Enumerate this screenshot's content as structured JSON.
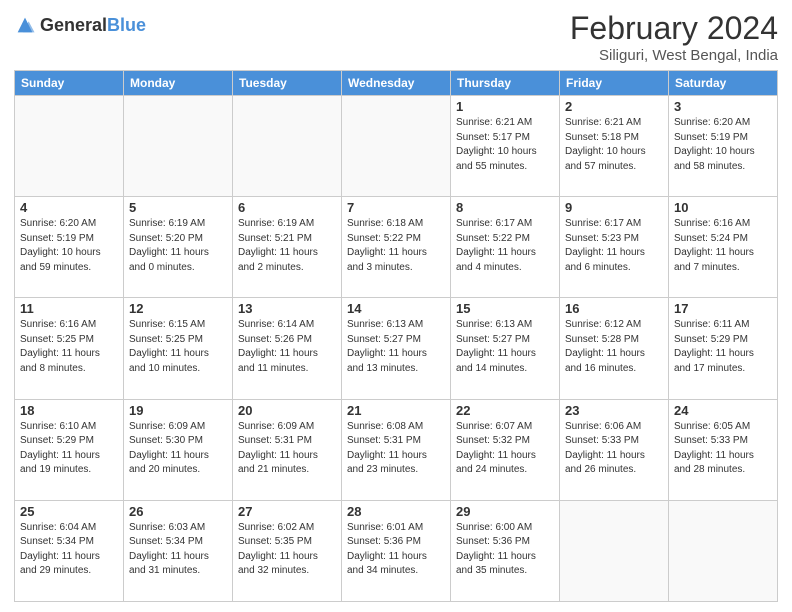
{
  "header": {
    "logo": {
      "general": "General",
      "blue": "Blue"
    },
    "title": "February 2024",
    "subtitle": "Siliguri, West Bengal, India"
  },
  "weekdays": [
    "Sunday",
    "Monday",
    "Tuesday",
    "Wednesday",
    "Thursday",
    "Friday",
    "Saturday"
  ],
  "weeks": [
    [
      {
        "day": "",
        "info": ""
      },
      {
        "day": "",
        "info": ""
      },
      {
        "day": "",
        "info": ""
      },
      {
        "day": "",
        "info": ""
      },
      {
        "day": "1",
        "info": "Sunrise: 6:21 AM\nSunset: 5:17 PM\nDaylight: 10 hours\nand 55 minutes."
      },
      {
        "day": "2",
        "info": "Sunrise: 6:21 AM\nSunset: 5:18 PM\nDaylight: 10 hours\nand 57 minutes."
      },
      {
        "day": "3",
        "info": "Sunrise: 6:20 AM\nSunset: 5:19 PM\nDaylight: 10 hours\nand 58 minutes."
      }
    ],
    [
      {
        "day": "4",
        "info": "Sunrise: 6:20 AM\nSunset: 5:19 PM\nDaylight: 10 hours\nand 59 minutes."
      },
      {
        "day": "5",
        "info": "Sunrise: 6:19 AM\nSunset: 5:20 PM\nDaylight: 11 hours\nand 0 minutes."
      },
      {
        "day": "6",
        "info": "Sunrise: 6:19 AM\nSunset: 5:21 PM\nDaylight: 11 hours\nand 2 minutes."
      },
      {
        "day": "7",
        "info": "Sunrise: 6:18 AM\nSunset: 5:22 PM\nDaylight: 11 hours\nand 3 minutes."
      },
      {
        "day": "8",
        "info": "Sunrise: 6:17 AM\nSunset: 5:22 PM\nDaylight: 11 hours\nand 4 minutes."
      },
      {
        "day": "9",
        "info": "Sunrise: 6:17 AM\nSunset: 5:23 PM\nDaylight: 11 hours\nand 6 minutes."
      },
      {
        "day": "10",
        "info": "Sunrise: 6:16 AM\nSunset: 5:24 PM\nDaylight: 11 hours\nand 7 minutes."
      }
    ],
    [
      {
        "day": "11",
        "info": "Sunrise: 6:16 AM\nSunset: 5:25 PM\nDaylight: 11 hours\nand 8 minutes."
      },
      {
        "day": "12",
        "info": "Sunrise: 6:15 AM\nSunset: 5:25 PM\nDaylight: 11 hours\nand 10 minutes."
      },
      {
        "day": "13",
        "info": "Sunrise: 6:14 AM\nSunset: 5:26 PM\nDaylight: 11 hours\nand 11 minutes."
      },
      {
        "day": "14",
        "info": "Sunrise: 6:13 AM\nSunset: 5:27 PM\nDaylight: 11 hours\nand 13 minutes."
      },
      {
        "day": "15",
        "info": "Sunrise: 6:13 AM\nSunset: 5:27 PM\nDaylight: 11 hours\nand 14 minutes."
      },
      {
        "day": "16",
        "info": "Sunrise: 6:12 AM\nSunset: 5:28 PM\nDaylight: 11 hours\nand 16 minutes."
      },
      {
        "day": "17",
        "info": "Sunrise: 6:11 AM\nSunset: 5:29 PM\nDaylight: 11 hours\nand 17 minutes."
      }
    ],
    [
      {
        "day": "18",
        "info": "Sunrise: 6:10 AM\nSunset: 5:29 PM\nDaylight: 11 hours\nand 19 minutes."
      },
      {
        "day": "19",
        "info": "Sunrise: 6:09 AM\nSunset: 5:30 PM\nDaylight: 11 hours\nand 20 minutes."
      },
      {
        "day": "20",
        "info": "Sunrise: 6:09 AM\nSunset: 5:31 PM\nDaylight: 11 hours\nand 21 minutes."
      },
      {
        "day": "21",
        "info": "Sunrise: 6:08 AM\nSunset: 5:31 PM\nDaylight: 11 hours\nand 23 minutes."
      },
      {
        "day": "22",
        "info": "Sunrise: 6:07 AM\nSunset: 5:32 PM\nDaylight: 11 hours\nand 24 minutes."
      },
      {
        "day": "23",
        "info": "Sunrise: 6:06 AM\nSunset: 5:33 PM\nDaylight: 11 hours\nand 26 minutes."
      },
      {
        "day": "24",
        "info": "Sunrise: 6:05 AM\nSunset: 5:33 PM\nDaylight: 11 hours\nand 28 minutes."
      }
    ],
    [
      {
        "day": "25",
        "info": "Sunrise: 6:04 AM\nSunset: 5:34 PM\nDaylight: 11 hours\nand 29 minutes."
      },
      {
        "day": "26",
        "info": "Sunrise: 6:03 AM\nSunset: 5:34 PM\nDaylight: 11 hours\nand 31 minutes."
      },
      {
        "day": "27",
        "info": "Sunrise: 6:02 AM\nSunset: 5:35 PM\nDaylight: 11 hours\nand 32 minutes."
      },
      {
        "day": "28",
        "info": "Sunrise: 6:01 AM\nSunset: 5:36 PM\nDaylight: 11 hours\nand 34 minutes."
      },
      {
        "day": "29",
        "info": "Sunrise: 6:00 AM\nSunset: 5:36 PM\nDaylight: 11 hours\nand 35 minutes."
      },
      {
        "day": "",
        "info": ""
      },
      {
        "day": "",
        "info": ""
      }
    ]
  ]
}
